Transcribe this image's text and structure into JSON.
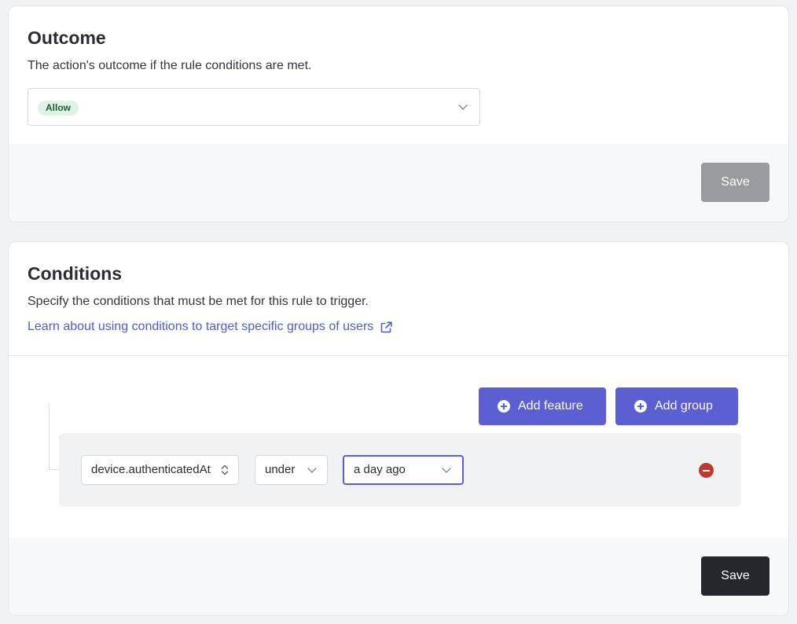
{
  "colors": {
    "accent": "#5b5fd1",
    "link": "#5459c9",
    "allow_badge_bg": "#dff2e6",
    "allow_badge_text": "#1f5a35",
    "remove": "#c0392b"
  },
  "outcome": {
    "title": "Outcome",
    "description": "The action's outcome if the rule conditions are met.",
    "selected": "Allow",
    "chevron_icon": "chevron-down-icon",
    "save_label": "Save",
    "save_disabled": true
  },
  "conditions": {
    "title": "Conditions",
    "description": "Specify the conditions that must be met for this rule to trigger.",
    "learn_link": "Learn about using conditions to target specific groups of users",
    "external_icon": "external-link-icon",
    "add_feature_label": "Add feature",
    "add_group_label": "Add group",
    "row": {
      "feature": "device.authenticatedAt",
      "operator": "under",
      "value": "a day ago"
    },
    "remove_icon": "minus-circle-icon",
    "save_label": "Save"
  }
}
